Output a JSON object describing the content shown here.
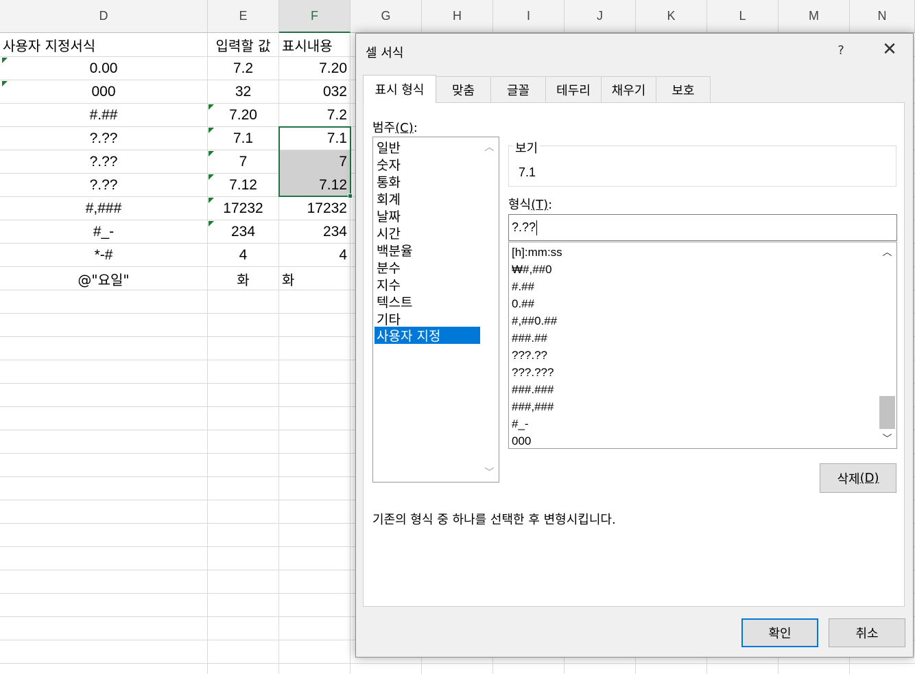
{
  "sheet": {
    "columns": [
      "D",
      "E",
      "F",
      "G",
      "H",
      "I",
      "J",
      "K",
      "L",
      "M",
      "N"
    ],
    "selected_column": "F",
    "header_row": [
      "사용자 지정서식",
      "입력할 값",
      "표시내용"
    ],
    "rows": [
      {
        "format": "0.00",
        "input": "7.2",
        "display": "7.20"
      },
      {
        "format": "000",
        "input": "32",
        "display": "032"
      },
      {
        "format": "#.##",
        "input": "7.20",
        "display": "7.2"
      },
      {
        "format": "?.??",
        "input": "7.1",
        "display": "7.1"
      },
      {
        "format": "?.??",
        "input": "7",
        "display": "7"
      },
      {
        "format": "?.??",
        "input": "7.12",
        "display": "7.12"
      },
      {
        "format": "#,###",
        "input": "17232",
        "display": "17232"
      },
      {
        "format": "#_-",
        "input": "234",
        "display": "234"
      },
      {
        "format": "*-#",
        "input": "4",
        "display": "4"
      },
      {
        "format": "@\"요일\"",
        "input": "화",
        "display": "화"
      }
    ]
  },
  "dialog": {
    "title": "셀 서식",
    "help": "?",
    "close": "✕",
    "tabs": [
      "표시 형식",
      "맞춤",
      "글꼴",
      "테두리",
      "채우기",
      "보호"
    ],
    "active_tab": "표시 형식",
    "category_label": "범주",
    "category_key": "(C)",
    "categories": [
      "일반",
      "숫자",
      "통화",
      "회계",
      "날짜",
      "시간",
      "백분율",
      "분수",
      "지수",
      "텍스트",
      "기타",
      "사용자 지정"
    ],
    "selected_category": "사용자 지정",
    "preview_label": "보기",
    "preview_value": "7.1",
    "type_label": "형식",
    "type_key": "(T)",
    "type_value": "?.??",
    "format_list": [
      "[h]:mm:ss",
      "₩#,##0",
      "#.##",
      "0.##",
      "#,##0.##",
      "###.##",
      "???.??",
      "???.???",
      "###.###",
      "###,###",
      "#_-",
      "000"
    ],
    "delete_label": "삭제",
    "delete_key": "(D)",
    "description": "기존의 형식 중 하나를 선택한 후 변형시킵니다.",
    "ok_label": "확인",
    "cancel_label": "취소"
  },
  "colors": {
    "excel_green": "#217346",
    "error_triangle": "#1e7b34",
    "selection_blue": "#0078d7",
    "selected_cell_fill": "#d0d0d0"
  }
}
